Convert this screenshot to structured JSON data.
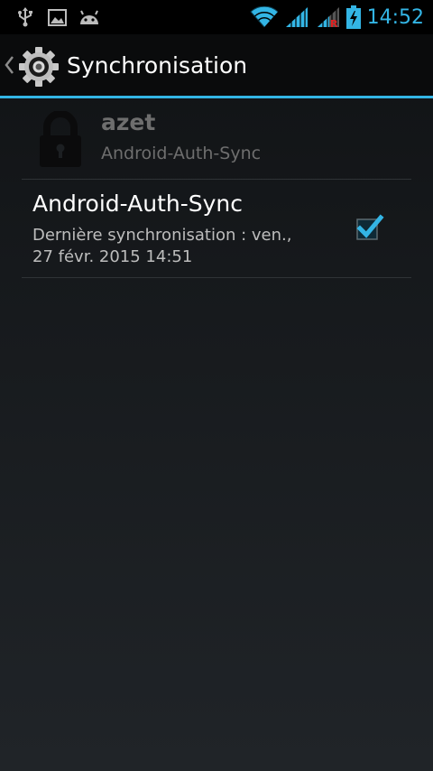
{
  "status_bar": {
    "time": "14:52",
    "icons": [
      "usb-icon",
      "picture-icon",
      "android-icon",
      "wifi-icon",
      "signal-icon",
      "signal-roaming-icon",
      "battery-charging-icon"
    ],
    "accent_color": "#33b5e5"
  },
  "action_bar": {
    "title": "Synchronisation",
    "icon": "settings-gear-icon"
  },
  "account": {
    "name": "azet",
    "type": "Android-Auth-Sync",
    "icon": "lock-icon"
  },
  "sync_items": [
    {
      "title": "Android-Auth-Sync",
      "summary_line1": "Dernière synchronisation : ven.,",
      "summary_line2": "27 févr. 2015 14:51",
      "checked": true
    }
  ]
}
